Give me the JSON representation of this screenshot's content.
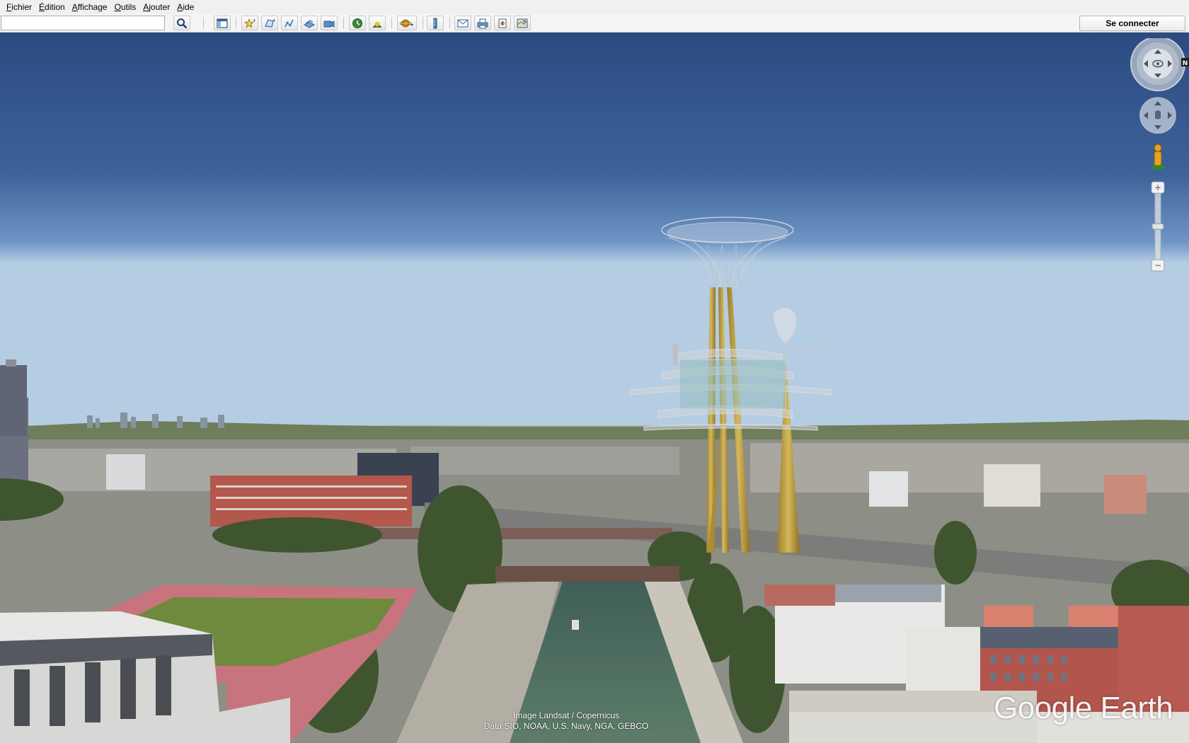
{
  "menubar": {
    "items": [
      {
        "label": "Fichier",
        "key": "F",
        "rest": "ichier"
      },
      {
        "label": "Édition",
        "key": "É",
        "rest": "dition"
      },
      {
        "label": "Affichage",
        "key": "A",
        "rest": "ffichage"
      },
      {
        "label": "Outils",
        "key": "O",
        "rest": "utils"
      },
      {
        "label": "Ajouter",
        "key": "A",
        "rest": "jouter"
      },
      {
        "label": "Aide",
        "key": "A",
        "rest": "ide"
      }
    ]
  },
  "toolbar": {
    "search_value": "",
    "signin_label": "Se connecter",
    "icons": [
      "search-icon",
      "sidebar-toggle-icon",
      "placemark-icon",
      "polygon-icon",
      "path-icon",
      "image-overlay-icon",
      "tour-record-icon",
      "historical-imagery-icon",
      "sunlight-icon",
      "planet-switch-icon",
      "ruler-icon",
      "email-icon",
      "print-icon",
      "save-image-icon",
      "view-in-maps-icon"
    ]
  },
  "map": {
    "credit_line1": "Image Landsat / Copernicus",
    "credit_line2": "Data SIO, NOAA, U.S. Navy, NGA, GEBCO",
    "brand": "Google Earth",
    "north_label": "N"
  },
  "colors": {
    "sky_top": "#2f4f84",
    "tower_gold": "#c9a94a",
    "canal_green": "#4f6d5b"
  }
}
